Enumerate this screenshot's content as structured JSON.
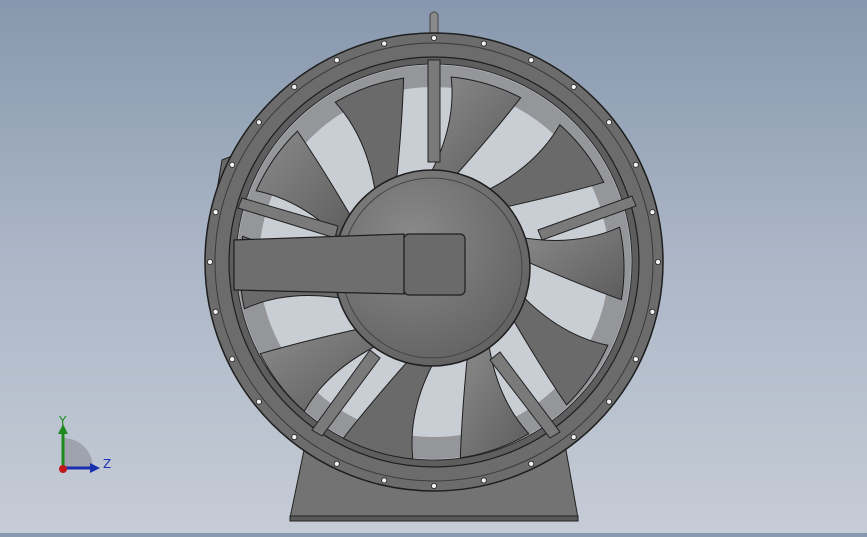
{
  "viewport": {
    "background_top": "#8797ad",
    "background_bottom": "#c6ccd6",
    "model": "axial-flow-fan",
    "blade_count": 10,
    "flange_bolt_count": 28
  },
  "triad": {
    "y_label": "Y",
    "z_label": "Z",
    "y_color": "#1d8a1d",
    "z_color": "#1a2fb0",
    "origin_color": "#c01818"
  }
}
